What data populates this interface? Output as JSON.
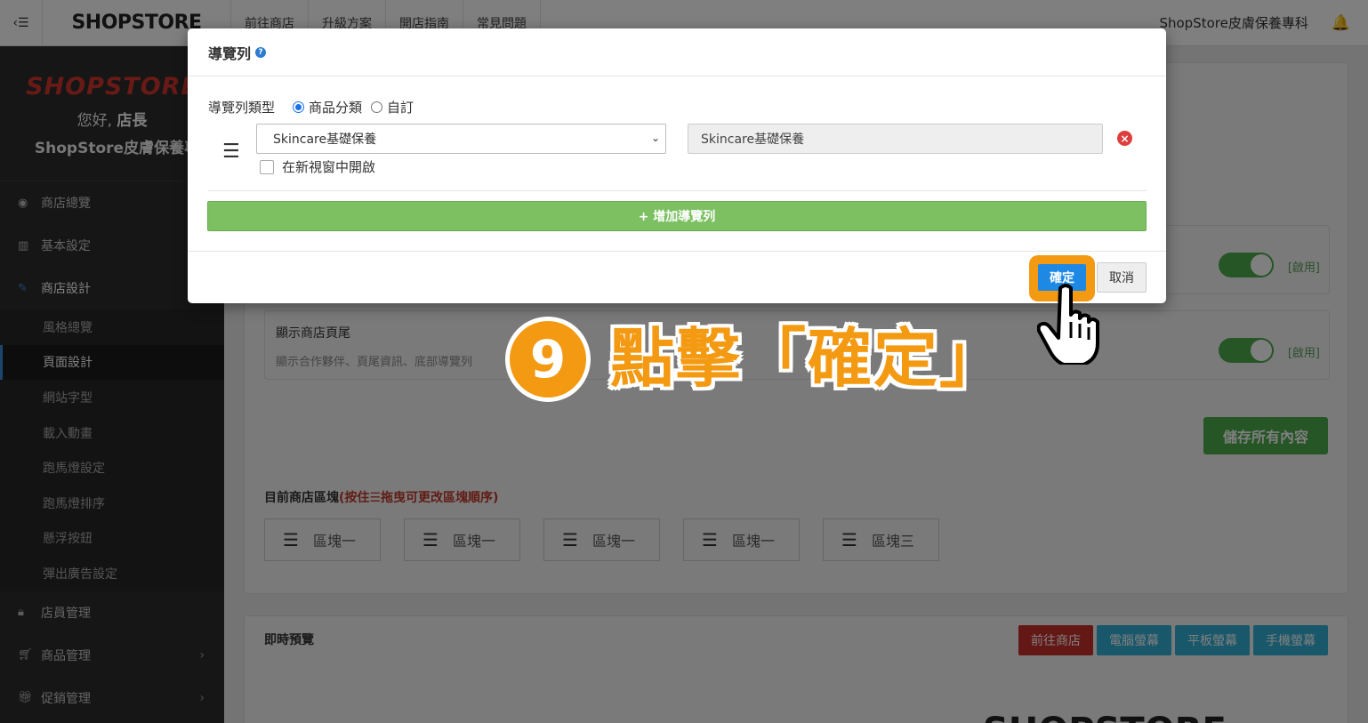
{
  "topbar": {
    "toggle_icon": "‹☰",
    "brand": "SHOPSTORE",
    "nav": [
      "前往商店",
      "升級方案",
      "開店指南",
      "常見問題"
    ],
    "store_name": "ShopStore皮膚保養專科",
    "bell_icon": "bell-icon"
  },
  "sidebar": {
    "logo": "SHOPSTORE",
    "hello_prefix": "您好,",
    "hello_role": "店長",
    "store_name": "ShopStore皮膚保養專科",
    "menu": [
      {
        "label": "商店總覽",
        "icon": "dashboard-icon"
      },
      {
        "label": "基本設定",
        "icon": "bank-icon"
      },
      {
        "label": "商店設計",
        "icon": "brush-icon"
      }
    ],
    "submenu": [
      "風格總覽",
      "頁面設計",
      "網站字型",
      "載入動畫",
      "跑馬燈設定",
      "跑馬燈排序",
      "懸浮按鈕",
      "彈出廣告設定"
    ],
    "menu_bottom": [
      {
        "label": "店員管理",
        "icon": "lock-icon"
      },
      {
        "label": "商品管理",
        "icon": "cart-icon"
      },
      {
        "label": "促銷管理",
        "icon": "gift-icon"
      }
    ]
  },
  "main": {
    "card1": {
      "switch_label": "[啟用]"
    },
    "card2": {
      "title": "顯示商店頁尾",
      "desc": "顯示合作夥伴、頁尾資訊、底部導覽列",
      "switch_label": "[啟用]"
    },
    "save_button": "儲存所有內容",
    "blocks_title": "目前商店區塊",
    "blocks_hint": "(按住☰拖曳可更改區塊順序)",
    "blocks": [
      "區塊一",
      "區塊一",
      "區塊一",
      "區塊一",
      "區塊三"
    ],
    "preview_title": "即時預覽",
    "preview_buttons": [
      "前往商店",
      "電腦螢幕",
      "平板螢幕",
      "手機螢幕"
    ],
    "preview_logo": "SHOPSTORE"
  },
  "modal": {
    "title": "導覽列",
    "type_label": "導覽列類型",
    "type_options": [
      "商品分類",
      "自訂"
    ],
    "type_selected": "商品分類",
    "select_value": "Skincare基礎保養",
    "text_value": "Skincare基礎保養",
    "new_window_label": "在新視窗中開啟",
    "add_button": "+ 增加導覽列",
    "confirm_button": "確定",
    "cancel_button": "取消"
  },
  "annotation": {
    "step_number": "9",
    "step_text": "點擊「確定」",
    "accent_color": "#f39a12"
  }
}
